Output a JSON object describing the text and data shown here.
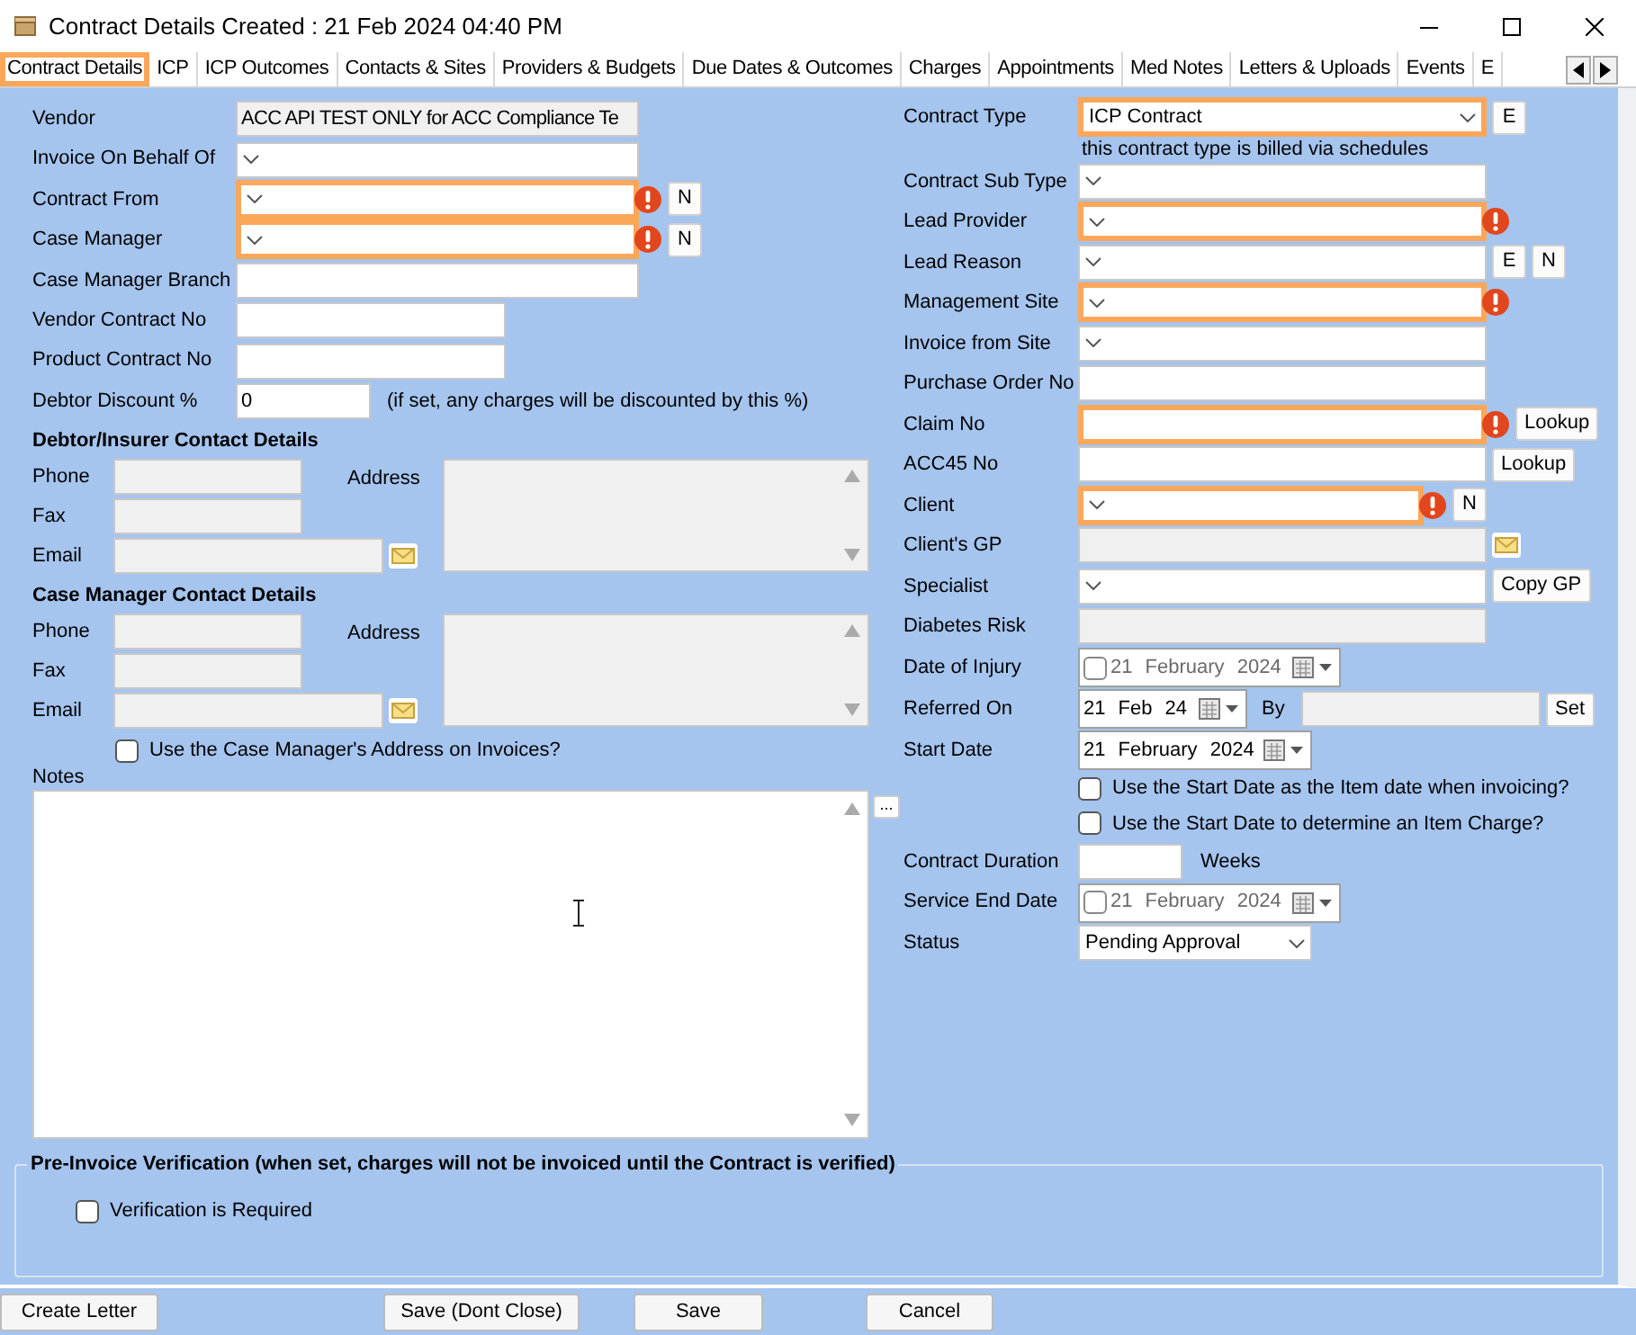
{
  "window": {
    "title": "Contract Details Created : 21 Feb 2024 04:40 PM"
  },
  "tabs": [
    {
      "label": "Contract Details",
      "selected": true
    },
    {
      "label": "ICP",
      "selected": false
    },
    {
      "label": "ICP Outcomes",
      "selected": false
    },
    {
      "label": "Contacts & Sites",
      "selected": false
    },
    {
      "label": "Providers & Budgets",
      "selected": false
    },
    {
      "label": "Due Dates & Outcomes",
      "selected": false
    },
    {
      "label": "Charges",
      "selected": false
    },
    {
      "label": "Appointments",
      "selected": false
    },
    {
      "label": "Med Notes",
      "selected": false
    },
    {
      "label": "Letters & Uploads",
      "selected": false
    },
    {
      "label": "Events",
      "selected": false
    },
    {
      "label": "E",
      "selected": false
    }
  ],
  "left_fields": [
    {
      "kind": "readonly",
      "label": "Vendor",
      "value": "ACC API TEST ONLY for ACC Compliance Te",
      "required": false,
      "error": false
    },
    {
      "kind": "combo",
      "label": "Invoice On Behalf Of",
      "required": false,
      "error": false
    },
    {
      "kind": "combo",
      "label": "Contract From",
      "required": true,
      "error": true,
      "buttons": [
        "N"
      ]
    },
    {
      "kind": "combo",
      "label": "Case Manager",
      "required": true,
      "error": true,
      "buttons": [
        "N"
      ]
    },
    {
      "kind": "text",
      "label": "Case Manager Branch",
      "required": false,
      "error": false
    },
    {
      "kind": "text",
      "label": "Vendor Contract No",
      "required": false,
      "error": false
    },
    {
      "kind": "text",
      "label": "Product Contract No",
      "required": false,
      "error": false
    },
    {
      "kind": "text",
      "label": "Debtor Discount %",
      "value": "0",
      "note": "(if set, any charges will be discounted by this %)",
      "required": false,
      "error": false
    }
  ],
  "contact_sections": [
    {
      "title": "Debtor/Insurer Contact Details",
      "fields": [
        "Phone",
        "Fax",
        "Email"
      ],
      "address_label": "Address"
    },
    {
      "title": "Case Manager Contact Details",
      "fields": [
        "Phone",
        "Fax",
        "Email"
      ],
      "address_label": "Address"
    }
  ],
  "use_address_checkbox": {
    "label": "Use the Case Manager's Address on Invoices?",
    "checked": false
  },
  "notes": {
    "label": "Notes",
    "button": "..."
  },
  "right_fields": [
    {
      "kind": "combo",
      "label": "Contract Type",
      "value": "ICP Contract",
      "required": true,
      "error": false,
      "buttons": [
        "E"
      ],
      "hint": "this contract type is billed via schedules"
    },
    {
      "kind": "combo",
      "label": "Contract Sub Type",
      "required": false,
      "error": false
    },
    {
      "kind": "combo",
      "label": "Lead Provider",
      "required": true,
      "error": true
    },
    {
      "kind": "combo",
      "label": "Lead Reason",
      "required": false,
      "error": false,
      "buttons": [
        "E",
        "N"
      ]
    },
    {
      "kind": "combo",
      "label": "Management Site",
      "required": true,
      "error": true
    },
    {
      "kind": "combo",
      "label": "Invoice from Site",
      "required": false,
      "error": false
    },
    {
      "kind": "text",
      "label": "Purchase Order No",
      "required": false,
      "error": false
    },
    {
      "kind": "text",
      "label": "Claim No",
      "required": true,
      "error": true,
      "buttons": [
        "Lookup"
      ]
    },
    {
      "kind": "text",
      "label": "ACC45 No",
      "required": false,
      "error": false,
      "buttons": [
        "Lookup"
      ]
    },
    {
      "kind": "combo",
      "label": "Client",
      "required": true,
      "error": true,
      "buttons": [
        "N"
      ]
    },
    {
      "kind": "readonly",
      "label": "Client's GP",
      "required": false,
      "error": false,
      "mail": true
    },
    {
      "kind": "combo",
      "label": "Specialist",
      "required": false,
      "error": false,
      "buttons": [
        "Copy GP"
      ]
    },
    {
      "kind": "readonly",
      "label": "Diabetes Risk",
      "required": false,
      "error": false
    },
    {
      "kind": "date",
      "label": "Date of Injury",
      "value": "21 February 2024",
      "checked": false
    },
    {
      "kind": "date",
      "label": "Referred On",
      "value": "21 Feb 24",
      "by_label": "By",
      "buttons": [
        "Set"
      ]
    },
    {
      "kind": "date",
      "label": "Start Date",
      "value": "21 February 2024"
    },
    {
      "kind": "checkbox",
      "label": "Use the Start Date as the Item date when invoicing?",
      "checked": false
    },
    {
      "kind": "checkbox",
      "label": "Use the Start Date to determine an Item Charge?",
      "checked": false
    },
    {
      "kind": "text",
      "label": "Contract Duration",
      "suffix": "Weeks",
      "required": false,
      "error": false
    },
    {
      "kind": "date",
      "label": "Service End Date",
      "value": "21 February 2024",
      "checked": false
    },
    {
      "kind": "combo",
      "label": "Status",
      "value": "Pending Approval",
      "required": false,
      "error": false
    }
  ],
  "verification": {
    "title": "Pre-Invoice Verification (when set, charges will not be invoiced until the Contract is verified)",
    "checkbox": {
      "label": "Verification is Required",
      "checked": false
    }
  },
  "footer_buttons": [
    "Create Letter",
    "Save (Dont Close)",
    "Save",
    "Cancel"
  ]
}
